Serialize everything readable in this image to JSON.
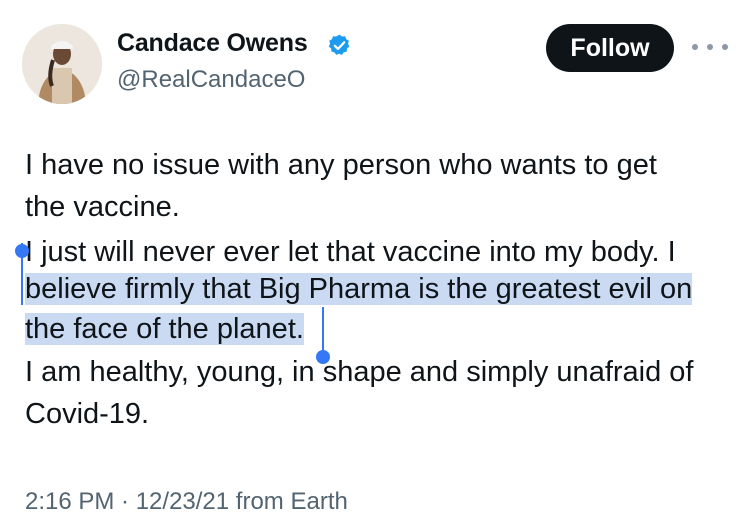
{
  "author": {
    "display_name": "Candace Owens",
    "handle": "@RealCandaceO",
    "verified": true,
    "verified_color": "#1d9bf0",
    "avatar_icon": "profile-photo"
  },
  "actions": {
    "follow_label": "Follow",
    "more_icon": "ellipsis-horizontal"
  },
  "tweet": {
    "lines": [
      "I have no issue with any person who wants to get",
      "the vaccine.",
      "I just will never ever let that vaccine into my body. I",
      "believe firmly that Big Pharma is the greatest evil on",
      "the face of the planet.",
      "I am healthy, young, in shape and simply unafraid of",
      "Covid-19."
    ],
    "selected_text": "believe firmly that Big Pharma is the greatest evil on the face of the planet.",
    "selection_color": "#c9daf2"
  },
  "meta": {
    "timestamp": "2:16 PM · 12/23/21 from Earth"
  }
}
